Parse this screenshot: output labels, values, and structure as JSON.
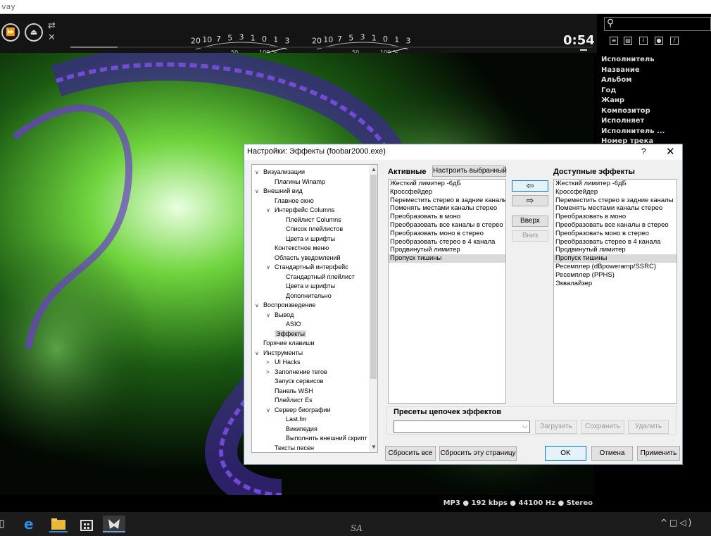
{
  "titlebar": {
    "text": "vay"
  },
  "player": {
    "time": "0:54",
    "seek_progress": 0.09,
    "meter_scale_top": [
      "20",
      "10",
      "7",
      "5",
      "3",
      "1",
      "0",
      "1",
      "3"
    ],
    "meter_scale_bottom": [
      "50",
      "100"
    ],
    "meter_unit": "%"
  },
  "tag_panel": {
    "items": [
      "Исполнитель",
      "Название",
      "Альбом",
      "Год",
      "Жанр",
      "Композитор",
      "Исполняет",
      "Исполнитель ...",
      "Номер трека"
    ]
  },
  "status_bar": {
    "text": "MP3 ● 192 kbps ● 44100 Hz ● Stereo"
  },
  "taskbar": {
    "center_text": "SA"
  },
  "dialog": {
    "title": "Настройки: Эффекты (foobar2000.exe)",
    "help": "?",
    "close": "✕",
    "tree": [
      {
        "label": "Визуализации",
        "level": 0,
        "expander": "∨"
      },
      {
        "label": "Плагины Winamp",
        "level": 1
      },
      {
        "label": "Внешний вид",
        "level": 0,
        "expander": "∨"
      },
      {
        "label": "Главное окно",
        "level": 1
      },
      {
        "label": "Интерфейс Columns",
        "level": 1,
        "expander": "∨"
      },
      {
        "label": "Плейлист Columns",
        "level": 2
      },
      {
        "label": "Список плейлистов",
        "level": 2
      },
      {
        "label": "Цвета и шрифты",
        "level": 2
      },
      {
        "label": "Контекстное меню",
        "level": 1
      },
      {
        "label": "Область уведомлений",
        "level": 1
      },
      {
        "label": "Стандартный интерфейс",
        "level": 1,
        "expander": "∨"
      },
      {
        "label": "Стандартный плейлист",
        "level": 2
      },
      {
        "label": "Цвета и шрифты",
        "level": 2
      },
      {
        "label": "Дополнительно",
        "level": 2
      },
      {
        "label": "Воспроизведение",
        "level": 0,
        "expander": "∨"
      },
      {
        "label": "Вывод",
        "level": 1,
        "expander": "∨"
      },
      {
        "label": "ASIO",
        "level": 2
      },
      {
        "label": "Эффекты",
        "level": 1,
        "selected": true
      },
      {
        "label": "Горячие клавиши",
        "level": 0
      },
      {
        "label": "Инструменты",
        "level": 0,
        "expander": "∨"
      },
      {
        "label": "UI Hacks",
        "level": 1,
        "expander": ">"
      },
      {
        "label": "Заполнение тегов",
        "level": 1,
        "expander": ">"
      },
      {
        "label": "Запуск сервисов",
        "level": 1
      },
      {
        "label": "Панель WSH",
        "level": 1
      },
      {
        "label": "Плейлист Es",
        "level": 1
      },
      {
        "label": "Сервер биографии",
        "level": 1,
        "expander": "∨"
      },
      {
        "label": "Last.fm",
        "level": 2
      },
      {
        "label": "Википедия",
        "level": 2
      },
      {
        "label": "Выполнить внешний скрипт",
        "level": 2
      },
      {
        "label": "Тексты песен",
        "level": 1
      }
    ],
    "active_label": "Активные",
    "configure_button": "Настроить выбранный",
    "active_list": [
      "Жесткий лимитер -6дБ",
      "Кроссфейдер",
      "Переместить стерео в задние каналы",
      "Поменять местами каналы стерео",
      "Преобразовать в моно",
      "Преобразовать все каналы в стерео",
      "Преобразовать моно в стерео",
      "Преобразовать стерео в 4 канала",
      "Продвинутый лимитер",
      "Пропуск тишины"
    ],
    "active_selected_index": 9,
    "add_button": "⇦",
    "remove_button": "⇨",
    "up_button": "Вверх",
    "down_button": "Вниз",
    "available_label": "Доступные эффекты",
    "available_list": [
      "Жесткий лимитер -6дБ",
      "Кроссфейдер",
      "Переместить стерео в задние каналы",
      "Поменять местами каналы стерео",
      "Преобразовать в моно",
      "Преобразовать все каналы в стерео",
      "Преобразовать моно в стерео",
      "Преобразовать стерео в 4 канала",
      "Продвинутый лимитер",
      "Пропуск тишины",
      "Ресемплер (dBpoweramp/SSRC)",
      "Ресемплер (PPHS)",
      "Эквалайзер"
    ],
    "available_selected_index": 9,
    "presets_label": "Пресеты цепочек эффектов",
    "preset_value": "",
    "load_button": "Загрузить",
    "save_button": "Сохранить",
    "delete_button": "Удалить",
    "reset_all_button": "Сбросить все",
    "reset_page_button": "Сбросить эту страницу",
    "ok_button": "OK",
    "cancel_button": "Отмена",
    "apply_button": "Применить"
  }
}
